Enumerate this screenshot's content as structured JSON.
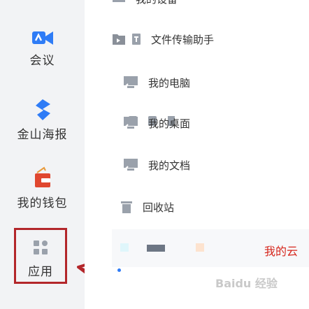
{
  "sidebar": {
    "items": [
      {
        "label": "会议"
      },
      {
        "label": "金山海报"
      },
      {
        "label": "我的钱包"
      },
      {
        "label": "应用"
      }
    ]
  },
  "panel": {
    "partial_top_label": "我的设备",
    "rows": [
      {
        "label": "文件传输助手"
      },
      {
        "label": "我的电脑"
      },
      {
        "label": "我的桌面"
      },
      {
        "label": "我的文档"
      },
      {
        "label": "回收站"
      }
    ],
    "tray_label": "我的云"
  },
  "watermark": "Baidu 经验",
  "colors": {
    "accent": "#2f7cf6",
    "highlight": "#b3262a",
    "wallet": "#e0472f"
  }
}
